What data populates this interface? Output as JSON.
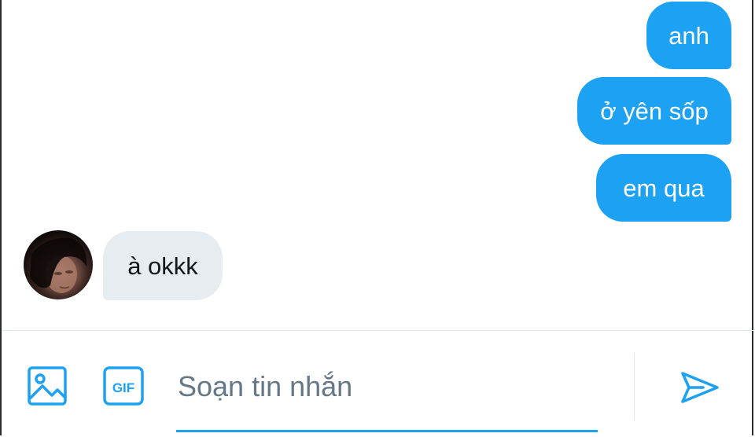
{
  "colors": {
    "accent": "#1da1f2",
    "incoming_bubble": "#e6ecf0",
    "placeholder": "#657786"
  },
  "messages": [
    {
      "direction": "outgoing",
      "text": "anh"
    },
    {
      "direction": "outgoing",
      "text": "ở yên sốp"
    },
    {
      "direction": "outgoing",
      "text": "em qua"
    },
    {
      "direction": "incoming",
      "text": "à okkk"
    }
  ],
  "compose": {
    "placeholder": "Soạn tin nhắn",
    "value": "",
    "gif_label": "GIF",
    "media_icon": "image-icon",
    "gif_icon": "gif-icon",
    "send_icon": "send-icon"
  }
}
